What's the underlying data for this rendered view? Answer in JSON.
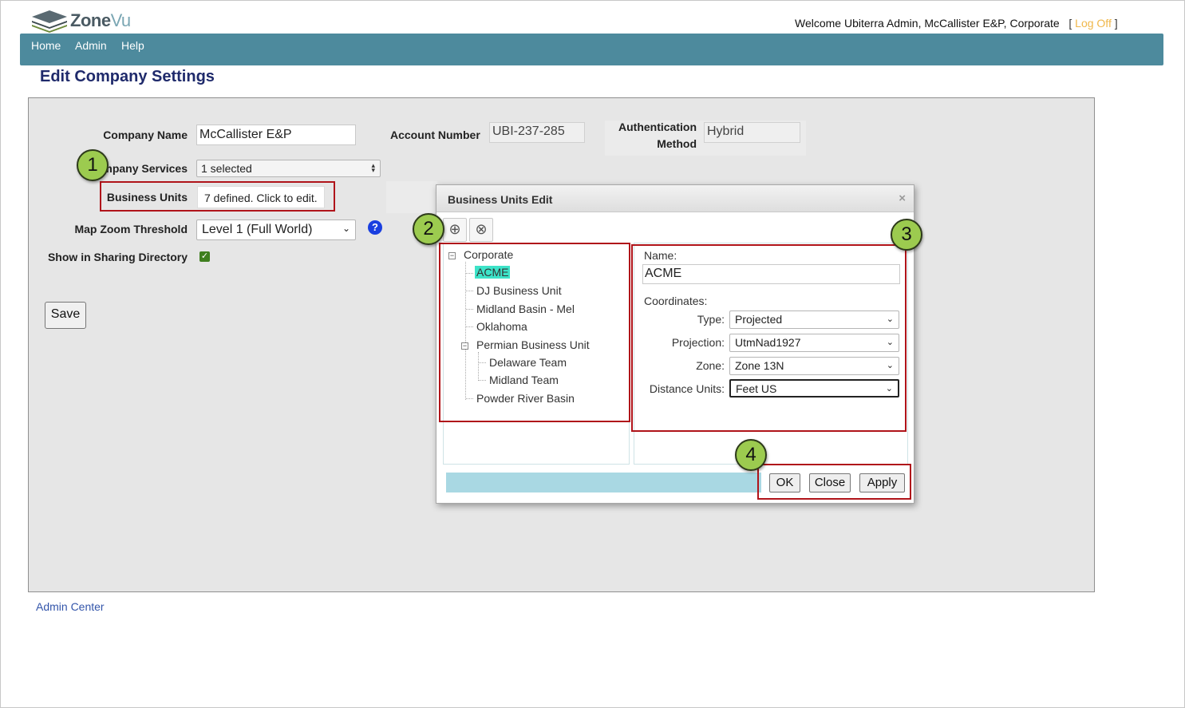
{
  "app": {
    "logo_text_1": "Zone",
    "logo_text_2": "Vu",
    "welcome": "Welcome Ubiterra Admin, McCallister E&P, Corporate",
    "bracket_open": "[",
    "logoff": "Log Off",
    "bracket_close": "]"
  },
  "nav": {
    "home": "Home",
    "admin": "Admin",
    "help": "Help"
  },
  "page_title": "Edit Company Settings",
  "form": {
    "company_name_label": "Company Name",
    "company_name_value": "McCallister E&P",
    "account_number_label": "Account Number",
    "account_number_value": "UBI-237-285",
    "auth_method_label_1": "Authentication",
    "auth_method_label_2": "Method",
    "auth_method_value": "Hybrid",
    "company_services_label": "Company Services",
    "company_services_value": "1 selected",
    "business_units_label": "Business Units",
    "business_units_value": "7 defined. Click to edit.",
    "map_zoom_label": "Map Zoom Threshold",
    "map_zoom_value": "Level 1 (Full World)",
    "help_glyph": "?",
    "sharing_label": "Show in Sharing Directory",
    "check_glyph": "✓",
    "save_label": "Save"
  },
  "callouts": {
    "c1": "1",
    "c2": "2",
    "c3": "3",
    "c4": "4"
  },
  "dialog": {
    "title": "Business Units Edit",
    "close_glyph": "×",
    "add_glyph": "⊕",
    "remove_glyph": "⊗",
    "tree": {
      "root": "Corporate",
      "acme": "ACME",
      "dj": "DJ Business Unit",
      "midland_basin": "Midland Basin - Mel",
      "oklahoma": "Oklahoma",
      "permian": "Permian Business Unit",
      "delaware": "Delaware Team",
      "midland_team": "Midland Team",
      "powder": "Powder River Basin",
      "collapse_glyph": "−"
    },
    "detail": {
      "name_label": "Name:",
      "name_value": "ACME",
      "coordinates_label": "Coordinates:",
      "type_label": "Type:",
      "type_value": "Projected",
      "projection_label": "Projection:",
      "projection_value": "UtmNad1927",
      "zone_label": "Zone:",
      "zone_value": "Zone 13N",
      "distance_label": "Distance Units:",
      "distance_value": "Feet US",
      "chevron": "⌄"
    },
    "buttons": {
      "ok": "OK",
      "close": "Close",
      "apply": "Apply"
    }
  },
  "footer": {
    "admin_center": "Admin Center"
  }
}
